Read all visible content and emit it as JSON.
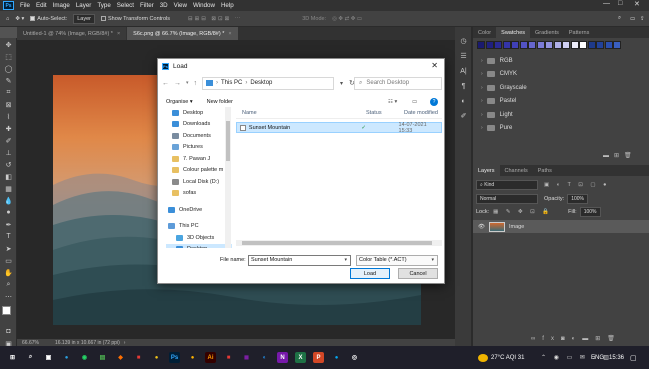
{
  "menubar": {
    "logo": "Ps",
    "items": [
      "File",
      "Edit",
      "Image",
      "Layer",
      "Type",
      "Select",
      "Filter",
      "3D",
      "View",
      "Window",
      "Help"
    ],
    "minimize": "—",
    "maximize": "□",
    "close": "✕"
  },
  "options_bar": {
    "auto_select_label": "Auto-Select:",
    "auto_select_value": "Layer",
    "show_transform_label": "Show Transform Controls",
    "mode_3d": "3D Mode:"
  },
  "tabs": [
    {
      "label": "Untitled-1 @ 74% (Image, RGB/8#) *",
      "close": "×"
    },
    {
      "label": "S6c.png @ 66.7% (Image, RGB/8#) *",
      "close": "×"
    }
  ],
  "status": {
    "zoom": "66.67%",
    "doc_info": "16.139 in x 10.667 in (72 ppi)"
  },
  "right_panel": {
    "top_tabs": [
      "Color",
      "Swatches",
      "Gradients",
      "Patterns"
    ],
    "swatch_colors": [
      "#1a1a6e",
      "#202080",
      "#2a2a95",
      "#3434a8",
      "#4040b8",
      "#5252c4",
      "#6666cc",
      "#7b7bd6",
      "#9393df",
      "#b0b0e8",
      "#cfcff2",
      "#ececf9",
      "#ffffff",
      "#1e3a8a",
      "#22429a",
      "#2b4fb0",
      "#3a5fc0"
    ],
    "swatch_groups": [
      "RGB",
      "CMYK",
      "Grayscale",
      "Pastel",
      "Light",
      "Pure"
    ],
    "layer_tabs": [
      "Layers",
      "Channels",
      "Paths"
    ],
    "kind_label": "Kind",
    "blend_mode": "Normal",
    "opacity_label": "Opacity:",
    "opacity_value": "100%",
    "lock_label": "Lock:",
    "fill_label": "Fill:",
    "fill_value": "100%",
    "layer_name": "Image"
  },
  "dialog": {
    "title": "Load",
    "close": "✕",
    "address": [
      "This PC",
      "Desktop"
    ],
    "search_placeholder": "Search Desktop",
    "organise": "Organise ▾",
    "new_folder": "New folder",
    "nav_items": [
      {
        "label": "Desktop",
        "color": "#3b8fd9"
      },
      {
        "label": "Downloads",
        "color": "#3b8fd9"
      },
      {
        "label": "Documents",
        "color": "#7a8ca0"
      },
      {
        "label": "Pictures",
        "color": "#6aa3d8"
      },
      {
        "label": "7. Pawan J",
        "color": "#e8c062"
      },
      {
        "label": "Colour palette m",
        "color": "#e8c062"
      },
      {
        "label": "Local Disk (D:)",
        "color": "#8a8a8a"
      },
      {
        "label": "sofas",
        "color": "#e8c062"
      },
      {
        "label": "",
        "color": ""
      },
      {
        "label": "OneDrive",
        "color": "#3b8fd9"
      },
      {
        "label": "",
        "color": ""
      },
      {
        "label": "This PC",
        "color": "#5d9bd9"
      },
      {
        "label": "3D Objects",
        "color": "#4aa5e0"
      },
      {
        "label": "Desktop",
        "color": "#3b8fd9"
      }
    ],
    "columns": {
      "name": "Name",
      "status": "Status",
      "date": "Date modified"
    },
    "files": [
      {
        "name": "Sunset Mountain",
        "status": "✓",
        "date": "14-07-2021 15:33"
      }
    ],
    "file_name_label": "File name:",
    "file_name_value": "Sunset Mountain",
    "file_type_value": "Color Table (*.ACT)",
    "load_button": "Load",
    "cancel_button": "Cancel"
  },
  "taskbar": {
    "weather": "27°C  AQI 31",
    "lang": "ENG",
    "time": "15:36",
    "apps": [
      {
        "glyph": "⊞",
        "color": "#ffffff",
        "bg": "transparent"
      },
      {
        "glyph": "⌕",
        "color": "#ffffff",
        "bg": "transparent"
      },
      {
        "glyph": "▣",
        "color": "#ffffff",
        "bg": "transparent"
      },
      {
        "glyph": "●",
        "color": "#2aa0e0",
        "bg": "transparent"
      },
      {
        "glyph": "◉",
        "color": "#25d366",
        "bg": "transparent"
      },
      {
        "glyph": "▤",
        "color": "#4caf50",
        "bg": "transparent"
      },
      {
        "glyph": "◆",
        "color": "#ff6f00",
        "bg": "transparent"
      },
      {
        "glyph": "■",
        "color": "#e53935",
        "bg": "transparent"
      },
      {
        "glyph": "●",
        "color": "#f0c419",
        "bg": "transparent"
      },
      {
        "glyph": "Ps",
        "color": "#31a8ff",
        "bg": "#001e36"
      },
      {
        "glyph": "●",
        "color": "#ffb300",
        "bg": "transparent"
      },
      {
        "glyph": "Ai",
        "color": "#ff9a00",
        "bg": "#330000"
      },
      {
        "glyph": "■",
        "color": "#e53935",
        "bg": "transparent"
      },
      {
        "glyph": "◼",
        "color": "#7b1fa2",
        "bg": "transparent"
      },
      {
        "glyph": "◐",
        "color": "#2196f3",
        "bg": "transparent"
      },
      {
        "glyph": "N",
        "color": "#ffffff",
        "bg": "#7719aa"
      },
      {
        "glyph": "X",
        "color": "#ffffff",
        "bg": "#1e7145"
      },
      {
        "glyph": "P",
        "color": "#ffffff",
        "bg": "#d24726"
      },
      {
        "glyph": "●",
        "color": "#03a9f4",
        "bg": "transparent"
      },
      {
        "glyph": "◎",
        "color": "#ffffff",
        "bg": "transparent"
      }
    ]
  }
}
